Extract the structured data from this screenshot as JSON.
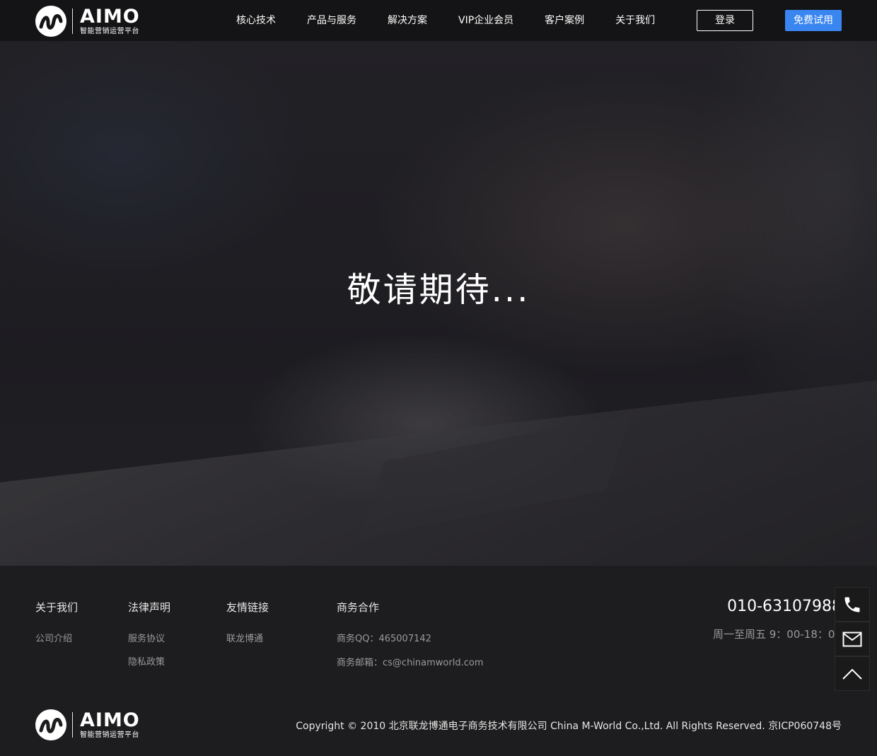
{
  "header": {
    "logo_brand": "AIMO",
    "logo_sub": "智能营销运营平台",
    "nav": [
      {
        "label": "核心技术"
      },
      {
        "label": "产品与服务"
      },
      {
        "label": "解决方案"
      },
      {
        "label": "VIP企业会员"
      },
      {
        "label": "客户案例"
      },
      {
        "label": "关于我们"
      }
    ],
    "login_label": "登录",
    "trial_label": "免费试用"
  },
  "hero": {
    "title": "敬请期待..."
  },
  "footer": {
    "columns": [
      {
        "heading": "关于我们",
        "links": [
          "公司介绍"
        ]
      },
      {
        "heading": "法律声明",
        "links": [
          "服务协议",
          "隐私政策"
        ]
      },
      {
        "heading": "友情链接",
        "links": [
          "联龙博通"
        ]
      }
    ],
    "business": {
      "heading": "商务合作",
      "qq": "商务QQ：465007142",
      "email": "商务邮箱：cs@chinamworld.com"
    },
    "phone": "010-63107988",
    "hours": "周一至周五  9：00-18：00",
    "logo_brand": "AIMO",
    "logo_sub": "智能营销运营平台",
    "copyright": "Copyright © 2010 北京联龙博通电子商务技术有限公司 China M-World Co.,Ltd. All Rights Reserved. 京ICP060748号"
  },
  "side_widget": {
    "icons": [
      "phone-icon",
      "mail-icon",
      "back-to-top-icon"
    ]
  },
  "colors": {
    "accent": "#3a86f0",
    "header_bg": "#141416",
    "footer_bg": "#1d1d1f"
  }
}
